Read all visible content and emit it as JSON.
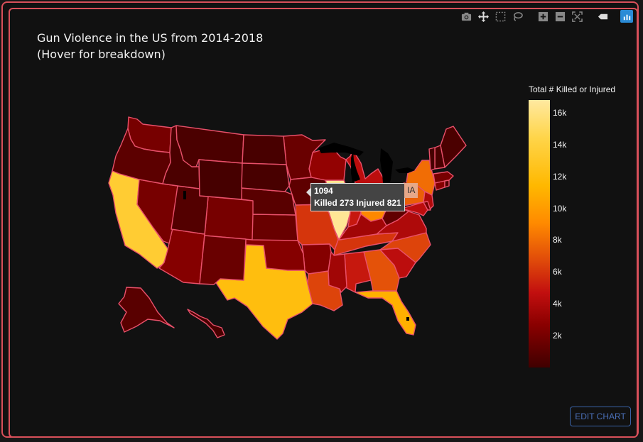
{
  "chart_data": {
    "type": "choropleth",
    "title_line1": "Gun Violence in the US from 2014-2018",
    "title_line2": "(Hover for breakdown)",
    "colorbar_title": "Total # Killed or Injured",
    "colorbar_ticks": [
      "16k",
      "14k",
      "12k",
      "10k",
      "8k",
      "6k",
      "4k",
      "2k"
    ],
    "colorbar_range": [
      0,
      16800
    ],
    "states": [
      {
        "code": "CA",
        "value": 13500
      },
      {
        "code": "TX",
        "value": 12000
      },
      {
        "code": "IL",
        "value": 16500
      },
      {
        "code": "FL",
        "value": 11000
      },
      {
        "code": "GA",
        "value": 7000
      },
      {
        "code": "MO",
        "value": 6000
      },
      {
        "code": "LA",
        "value": 6500
      },
      {
        "code": "OH",
        "value": 9000
      },
      {
        "code": "PA",
        "value": 7500
      },
      {
        "code": "NY",
        "value": 8000
      },
      {
        "code": "NC",
        "value": 6500
      },
      {
        "code": "TN",
        "value": 6000
      },
      {
        "code": "AL",
        "value": 5000
      },
      {
        "code": "SC",
        "value": 4500
      },
      {
        "code": "MI",
        "value": 4500
      },
      {
        "code": "VA",
        "value": 4000
      },
      {
        "code": "IN",
        "value": 5000
      },
      {
        "code": "MD",
        "value": 4500
      },
      {
        "code": "NJ",
        "value": 4000
      },
      {
        "code": "MS",
        "value": 3500
      },
      {
        "code": "KY",
        "value": 3500
      },
      {
        "code": "WI",
        "value": 3000
      },
      {
        "code": "AZ",
        "value": 2500
      },
      {
        "code": "AR",
        "value": 2500
      },
      {
        "code": "OK",
        "value": 2500
      },
      {
        "code": "CO",
        "value": 2000
      },
      {
        "code": "WA",
        "value": 2000
      },
      {
        "code": "MN",
        "value": 1500
      },
      {
        "code": "KS",
        "value": 1500
      },
      {
        "code": "NV",
        "value": 2000
      },
      {
        "code": "NM",
        "value": 1500
      },
      {
        "code": "OR",
        "value": 1000
      },
      {
        "code": "IA",
        "value": 1094,
        "killed": 273,
        "injured": 821
      },
      {
        "code": "NE",
        "value": 900
      },
      {
        "code": "UT",
        "value": 700
      },
      {
        "code": "WV",
        "value": 1200
      },
      {
        "code": "CT",
        "value": 2500
      },
      {
        "code": "MA",
        "value": 2000
      },
      {
        "code": "DE",
        "value": 2000
      },
      {
        "code": "RI",
        "value": 500
      },
      {
        "code": "ID",
        "value": 400
      },
      {
        "code": "MT",
        "value": 400
      },
      {
        "code": "WY",
        "value": 200
      },
      {
        "code": "ND",
        "value": 300
      },
      {
        "code": "SD",
        "value": 300
      },
      {
        "code": "ME",
        "value": 400
      },
      {
        "code": "NH",
        "value": 300
      },
      {
        "code": "VT",
        "value": 200
      },
      {
        "code": "AK",
        "value": 900
      },
      {
        "code": "HI",
        "value": 300
      }
    ]
  },
  "tooltip": {
    "total": "1094",
    "breakdown": "Killed 273 Injured 821",
    "state": "IA"
  },
  "edit_button": "EDIT CHART",
  "modebar": [
    "camera-icon",
    "pan-icon",
    "box-select-icon",
    "lasso-icon",
    "zoom-in-icon",
    "zoom-out-icon",
    "reset-icon",
    "hover-closest-icon",
    "plotly-logo-icon"
  ],
  "colors": {
    "background": "#111111",
    "border": "#d9505a",
    "state_outline": "#e8506a"
  }
}
